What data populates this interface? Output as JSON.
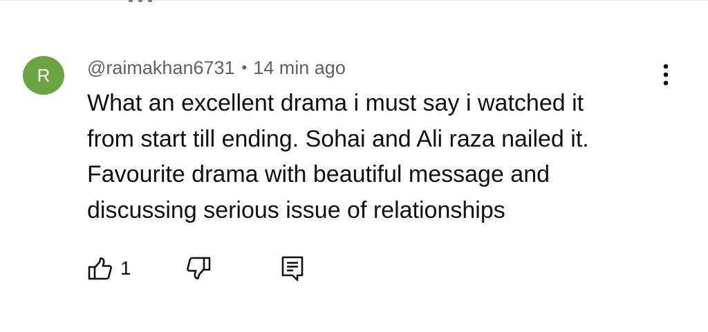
{
  "comment": {
    "avatar_letter": "R",
    "avatar_color": "#6aa443",
    "handle": "@raimakhan6731",
    "separator": "•",
    "time_ago": "14 min ago",
    "text_lines": [
      "What an excellent drama i must say i watched it",
      "from start till ending. Sohai and Ali raza nailed it.",
      "Favourite drama with beautiful message and",
      "discussing serious issue of relationships"
    ],
    "like_count": "1"
  },
  "icons": {
    "like": "thumb-up-icon",
    "dislike": "thumb-down-icon",
    "reply": "reply-comment-icon",
    "more": "more-vertical-icon"
  }
}
